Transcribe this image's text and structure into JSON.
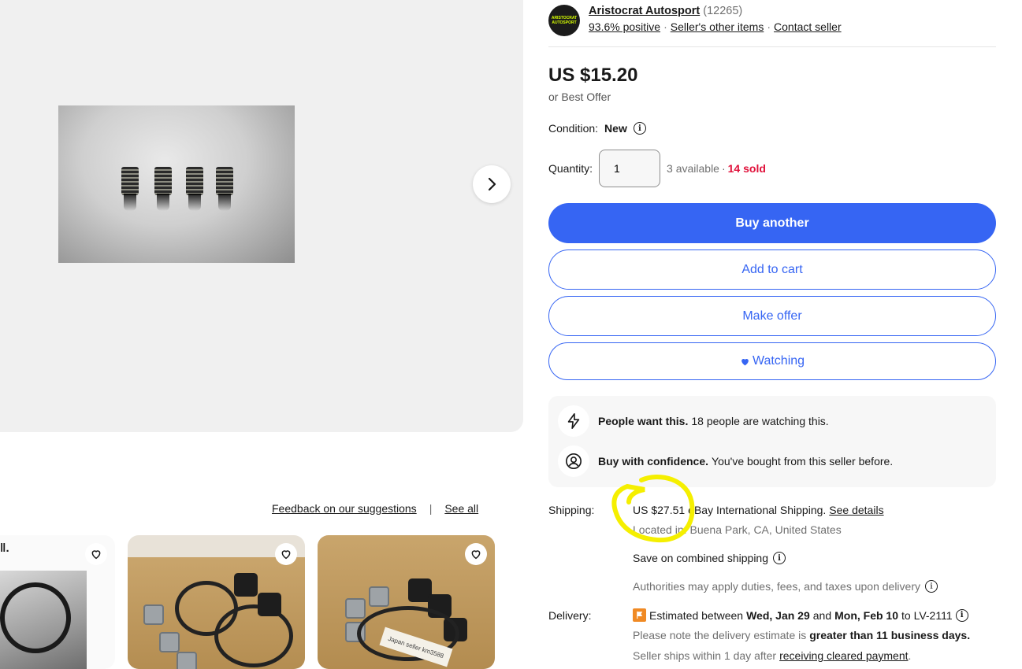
{
  "gallery": {
    "next_icon": "chevron-right-icon"
  },
  "suggestions": {
    "feedback_link": "Feedback on our suggestions",
    "separator": "|",
    "see_all": "See all",
    "card1_mark": "ǁ.",
    "card3_tag": "Japan seller km3588"
  },
  "seller": {
    "logo_text": "ARISTOCRAT AUTOSPORT",
    "name": "Aristocrat Autosport",
    "count": "(12265)",
    "positive": "93.6% positive",
    "other_items": "Seller's other items",
    "contact": "Contact seller"
  },
  "price": {
    "amount": "US $15.20",
    "best_offer": "or Best Offer"
  },
  "condition": {
    "label": "Condition:",
    "value": "New"
  },
  "quantity": {
    "label": "Quantity:",
    "value": "1",
    "available": "3 available",
    "dot": "·",
    "sold": "14 sold"
  },
  "buttons": {
    "buy_another": "Buy another",
    "add_to_cart": "Add to cart",
    "make_offer": "Make offer",
    "watching": "Watching"
  },
  "signals": {
    "people_bold": "People want this.",
    "people_text": "18 people are watching this.",
    "confidence_bold": "Buy with confidence.",
    "confidence_text": "You've bought from this seller before."
  },
  "shipping": {
    "label": "Shipping:",
    "price": "US $27.51",
    "method": "eBay International Shipping.",
    "see_details": "See details",
    "located_prefix": "Located in:",
    "location": "Buena Park, CA, United States",
    "combined": "Save on combined shipping",
    "duties": "Authorities may apply duties, fees, and taxes upon delivery"
  },
  "delivery": {
    "label": "Delivery:",
    "estimated_prefix": "Estimated between",
    "date_start": "Wed, Jan 29",
    "and": "and",
    "date_end": "Mon, Feb 10",
    "to_dest": "to LV-2111",
    "note_prefix": "Please note the delivery estimate is",
    "note_bold": "greater than 11 business days.",
    "ships_prefix": "Seller ships within 1 day after",
    "ships_link": "receiving cleared payment",
    "ships_suffix": "."
  },
  "colors": {
    "accent": "#3665f3",
    "sold_red": "#e0103a",
    "annotation": "#f5ef00"
  }
}
